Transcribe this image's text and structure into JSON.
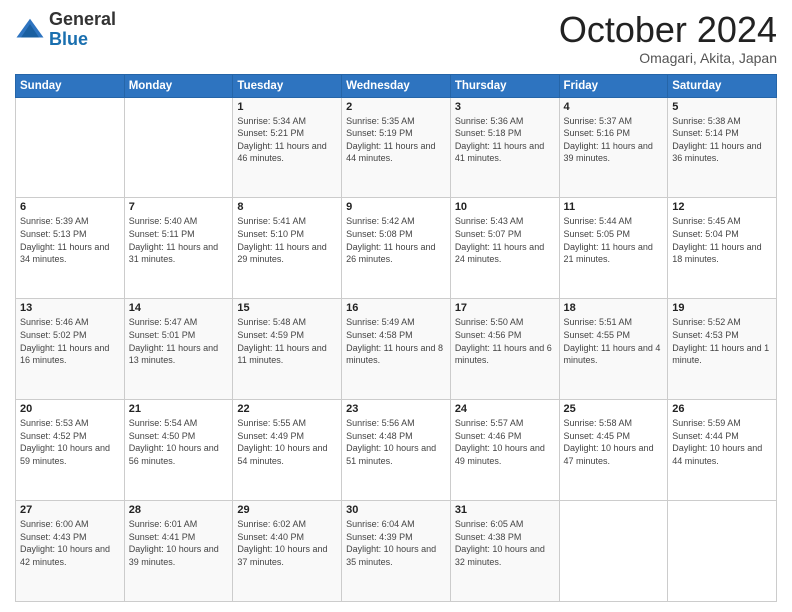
{
  "logo": {
    "general": "General",
    "blue": "Blue"
  },
  "header": {
    "title": "October 2024",
    "subtitle": "Omagari, Akita, Japan"
  },
  "weekdays": [
    "Sunday",
    "Monday",
    "Tuesday",
    "Wednesday",
    "Thursday",
    "Friday",
    "Saturday"
  ],
  "weeks": [
    [
      {
        "day": "",
        "sunrise": "",
        "sunset": "",
        "daylight": ""
      },
      {
        "day": "",
        "sunrise": "",
        "sunset": "",
        "daylight": ""
      },
      {
        "day": "1",
        "sunrise": "Sunrise: 5:34 AM",
        "sunset": "Sunset: 5:21 PM",
        "daylight": "Daylight: 11 hours and 46 minutes."
      },
      {
        "day": "2",
        "sunrise": "Sunrise: 5:35 AM",
        "sunset": "Sunset: 5:19 PM",
        "daylight": "Daylight: 11 hours and 44 minutes."
      },
      {
        "day": "3",
        "sunrise": "Sunrise: 5:36 AM",
        "sunset": "Sunset: 5:18 PM",
        "daylight": "Daylight: 11 hours and 41 minutes."
      },
      {
        "day": "4",
        "sunrise": "Sunrise: 5:37 AM",
        "sunset": "Sunset: 5:16 PM",
        "daylight": "Daylight: 11 hours and 39 minutes."
      },
      {
        "day": "5",
        "sunrise": "Sunrise: 5:38 AM",
        "sunset": "Sunset: 5:14 PM",
        "daylight": "Daylight: 11 hours and 36 minutes."
      }
    ],
    [
      {
        "day": "6",
        "sunrise": "Sunrise: 5:39 AM",
        "sunset": "Sunset: 5:13 PM",
        "daylight": "Daylight: 11 hours and 34 minutes."
      },
      {
        "day": "7",
        "sunrise": "Sunrise: 5:40 AM",
        "sunset": "Sunset: 5:11 PM",
        "daylight": "Daylight: 11 hours and 31 minutes."
      },
      {
        "day": "8",
        "sunrise": "Sunrise: 5:41 AM",
        "sunset": "Sunset: 5:10 PM",
        "daylight": "Daylight: 11 hours and 29 minutes."
      },
      {
        "day": "9",
        "sunrise": "Sunrise: 5:42 AM",
        "sunset": "Sunset: 5:08 PM",
        "daylight": "Daylight: 11 hours and 26 minutes."
      },
      {
        "day": "10",
        "sunrise": "Sunrise: 5:43 AM",
        "sunset": "Sunset: 5:07 PM",
        "daylight": "Daylight: 11 hours and 24 minutes."
      },
      {
        "day": "11",
        "sunrise": "Sunrise: 5:44 AM",
        "sunset": "Sunset: 5:05 PM",
        "daylight": "Daylight: 11 hours and 21 minutes."
      },
      {
        "day": "12",
        "sunrise": "Sunrise: 5:45 AM",
        "sunset": "Sunset: 5:04 PM",
        "daylight": "Daylight: 11 hours and 18 minutes."
      }
    ],
    [
      {
        "day": "13",
        "sunrise": "Sunrise: 5:46 AM",
        "sunset": "Sunset: 5:02 PM",
        "daylight": "Daylight: 11 hours and 16 minutes."
      },
      {
        "day": "14",
        "sunrise": "Sunrise: 5:47 AM",
        "sunset": "Sunset: 5:01 PM",
        "daylight": "Daylight: 11 hours and 13 minutes."
      },
      {
        "day": "15",
        "sunrise": "Sunrise: 5:48 AM",
        "sunset": "Sunset: 4:59 PM",
        "daylight": "Daylight: 11 hours and 11 minutes."
      },
      {
        "day": "16",
        "sunrise": "Sunrise: 5:49 AM",
        "sunset": "Sunset: 4:58 PM",
        "daylight": "Daylight: 11 hours and 8 minutes."
      },
      {
        "day": "17",
        "sunrise": "Sunrise: 5:50 AM",
        "sunset": "Sunset: 4:56 PM",
        "daylight": "Daylight: 11 hours and 6 minutes."
      },
      {
        "day": "18",
        "sunrise": "Sunrise: 5:51 AM",
        "sunset": "Sunset: 4:55 PM",
        "daylight": "Daylight: 11 hours and 4 minutes."
      },
      {
        "day": "19",
        "sunrise": "Sunrise: 5:52 AM",
        "sunset": "Sunset: 4:53 PM",
        "daylight": "Daylight: 11 hours and 1 minute."
      }
    ],
    [
      {
        "day": "20",
        "sunrise": "Sunrise: 5:53 AM",
        "sunset": "Sunset: 4:52 PM",
        "daylight": "Daylight: 10 hours and 59 minutes."
      },
      {
        "day": "21",
        "sunrise": "Sunrise: 5:54 AM",
        "sunset": "Sunset: 4:50 PM",
        "daylight": "Daylight: 10 hours and 56 minutes."
      },
      {
        "day": "22",
        "sunrise": "Sunrise: 5:55 AM",
        "sunset": "Sunset: 4:49 PM",
        "daylight": "Daylight: 10 hours and 54 minutes."
      },
      {
        "day": "23",
        "sunrise": "Sunrise: 5:56 AM",
        "sunset": "Sunset: 4:48 PM",
        "daylight": "Daylight: 10 hours and 51 minutes."
      },
      {
        "day": "24",
        "sunrise": "Sunrise: 5:57 AM",
        "sunset": "Sunset: 4:46 PM",
        "daylight": "Daylight: 10 hours and 49 minutes."
      },
      {
        "day": "25",
        "sunrise": "Sunrise: 5:58 AM",
        "sunset": "Sunset: 4:45 PM",
        "daylight": "Daylight: 10 hours and 47 minutes."
      },
      {
        "day": "26",
        "sunrise": "Sunrise: 5:59 AM",
        "sunset": "Sunset: 4:44 PM",
        "daylight": "Daylight: 10 hours and 44 minutes."
      }
    ],
    [
      {
        "day": "27",
        "sunrise": "Sunrise: 6:00 AM",
        "sunset": "Sunset: 4:43 PM",
        "daylight": "Daylight: 10 hours and 42 minutes."
      },
      {
        "day": "28",
        "sunrise": "Sunrise: 6:01 AM",
        "sunset": "Sunset: 4:41 PM",
        "daylight": "Daylight: 10 hours and 39 minutes."
      },
      {
        "day": "29",
        "sunrise": "Sunrise: 6:02 AM",
        "sunset": "Sunset: 4:40 PM",
        "daylight": "Daylight: 10 hours and 37 minutes."
      },
      {
        "day": "30",
        "sunrise": "Sunrise: 6:04 AM",
        "sunset": "Sunset: 4:39 PM",
        "daylight": "Daylight: 10 hours and 35 minutes."
      },
      {
        "day": "31",
        "sunrise": "Sunrise: 6:05 AM",
        "sunset": "Sunset: 4:38 PM",
        "daylight": "Daylight: 10 hours and 32 minutes."
      },
      {
        "day": "",
        "sunrise": "",
        "sunset": "",
        "daylight": ""
      },
      {
        "day": "",
        "sunrise": "",
        "sunset": "",
        "daylight": ""
      }
    ]
  ]
}
